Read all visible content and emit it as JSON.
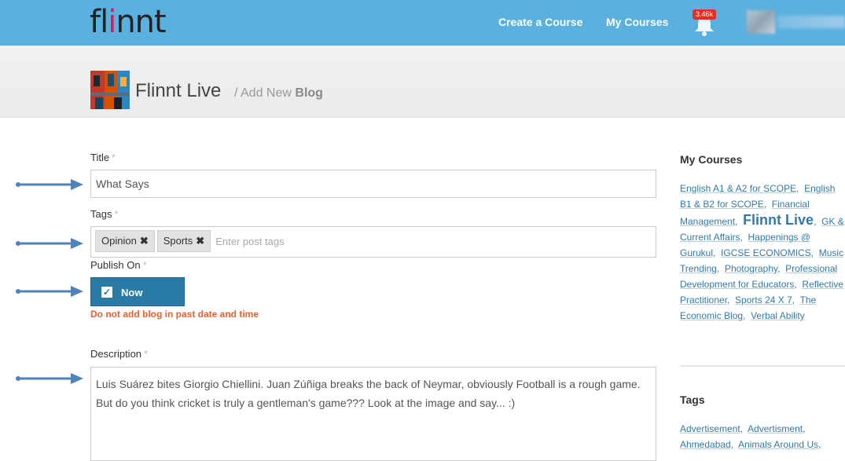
{
  "header": {
    "logo": "flinnt",
    "nav": {
      "create_course": "Create a Course",
      "my_courses": "My Courses"
    },
    "notifications_badge": "3.46k",
    "icons": {
      "bell": "bell-icon"
    },
    "colors": {
      "topbar": "#5ab0df",
      "accent": "#2a7aa6",
      "warning": "#e8612c",
      "link": "#3579a8"
    }
  },
  "subheader": {
    "course_title": "Flinnt Live",
    "breadcrumb_prefix": "/ Add New",
    "breadcrumb_current": "Blog"
  },
  "form": {
    "title_label": "Title",
    "required_mark": "*",
    "title_value": "What Says",
    "tags_label": "Tags",
    "tags": [
      "Opinion",
      "Sports"
    ],
    "tags_placeholder": "Enter post tags",
    "publish_label": "Publish On",
    "publish_button": "Now",
    "publish_checked": true,
    "warning": "Do not add blog in past date and time",
    "description_label": "Description",
    "description_value": "Luis Suárez bites Giorgio Chiellini. Juan Zúñiga breaks the back of Neymar, obviously Football is a rough game. But do you think cricket is truly a gentleman's game??? Look at the image and say... :)"
  },
  "sidebar": {
    "my_courses_heading": "My Courses",
    "courses": [
      "English A1 & A2 for SCOPE",
      "English B1 & B2 for SCOPE",
      "Financial Management",
      "Flinnt Live",
      "GK & Current Affairs",
      "Happenings @ Gurukul",
      "IGCSE ECONOMICS",
      "Music Trending",
      "Photography",
      "Professional Development for Educators",
      "Reflective Practitioner",
      "Sports 24 X 7",
      "The Economic Blog",
      "Verbal Ability"
    ],
    "tags_heading": "Tags",
    "tags": [
      "Advertisement",
      "Advertisment",
      "Ahmedabad",
      "Animals Around Us"
    ]
  }
}
